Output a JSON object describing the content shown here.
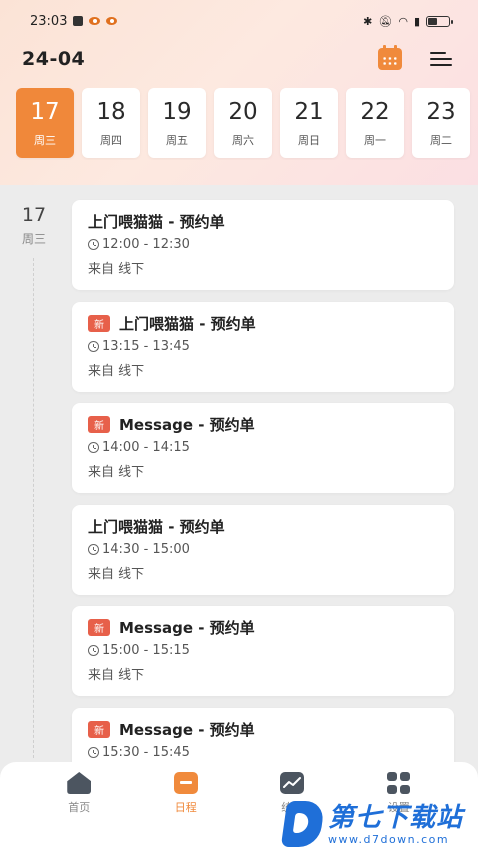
{
  "status_bar": {
    "time": "23:03",
    "indicators": [
      "notification-box-icon",
      "eye-app-icon",
      "eye-app-icon"
    ],
    "right_icons": [
      "bluetooth-icon",
      "mute-icon",
      "wifi-icon",
      "sim-icon",
      "battery-icon"
    ]
  },
  "header": {
    "month": "24-04",
    "calendar_icon": "calendar-icon",
    "menu_icon": "menu-icon"
  },
  "days": [
    {
      "num": "17",
      "week": "周三",
      "active": true
    },
    {
      "num": "18",
      "week": "周四",
      "active": false
    },
    {
      "num": "19",
      "week": "周五",
      "active": false
    },
    {
      "num": "20",
      "week": "周六",
      "active": false
    },
    {
      "num": "21",
      "week": "周日",
      "active": false
    },
    {
      "num": "22",
      "week": "周一",
      "active": false
    },
    {
      "num": "23",
      "week": "周二",
      "active": false
    }
  ],
  "timeline": {
    "date_num": "17",
    "date_week": "周三"
  },
  "bookings": [
    {
      "title": "上门喂猫猫 - 预约单",
      "new": false,
      "badge": "",
      "time": "12:00 - 12:30",
      "source": "来自 线下"
    },
    {
      "title": "上门喂猫猫 - 预约单",
      "new": true,
      "badge": "新",
      "time": "13:15 - 13:45",
      "source": "来自 线下"
    },
    {
      "title": "Message - 预约单",
      "new": true,
      "badge": "新",
      "time": "14:00 - 14:15",
      "source": "来自 线下"
    },
    {
      "title": "上门喂猫猫 - 预约单",
      "new": false,
      "badge": "",
      "time": "14:30 - 15:00",
      "source": "来自 线下"
    },
    {
      "title": "Message - 预约单",
      "new": true,
      "badge": "新",
      "time": "15:00 - 15:15",
      "source": "来自 线下"
    },
    {
      "title": "Message - 预约单",
      "new": true,
      "badge": "新",
      "time": "15:30 - 15:45",
      "source": ""
    }
  ],
  "tabbar": {
    "tabs": [
      {
        "label": "首页",
        "icon": "home-icon",
        "active": false
      },
      {
        "label": "日程",
        "icon": "schedule-icon",
        "active": true
      },
      {
        "label": "统计",
        "icon": "stats-icon",
        "active": false
      },
      {
        "label": "设置",
        "icon": "settings-icon",
        "active": false
      }
    ]
  },
  "watermark": {
    "name": "第七下载站",
    "url": "www.d7down.com"
  },
  "colors": {
    "accent": "#f08a3c",
    "badge": "#e7604a",
    "watermark": "#1f6fd8"
  }
}
